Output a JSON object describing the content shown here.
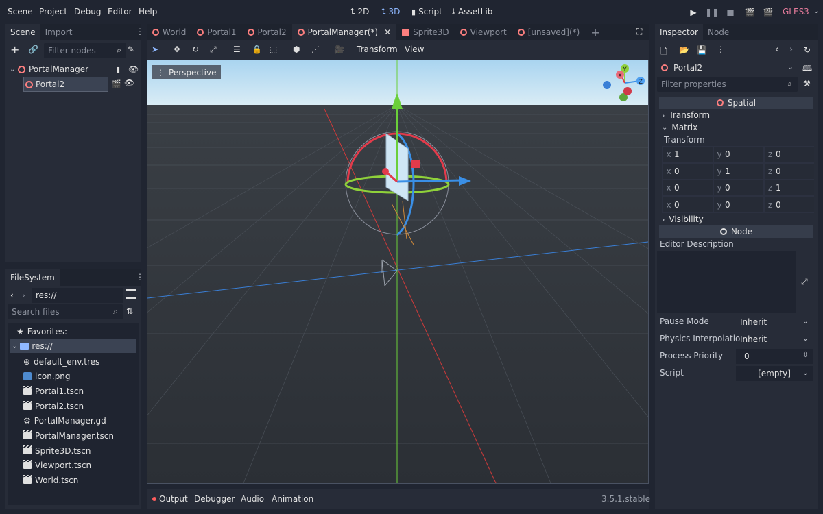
{
  "menu": [
    "Scene",
    "Project",
    "Debug",
    "Editor",
    "Help"
  ],
  "workspaces": [
    "2D",
    "3D",
    "Script",
    "AssetLib"
  ],
  "renderer": "GLES3",
  "scene_dock": {
    "tabs": [
      "Scene",
      "Import"
    ],
    "filter_placeholder": "Filter nodes",
    "nodes": [
      "PortalManager",
      "Portal2"
    ]
  },
  "filesystem": {
    "tab": "FileSystem",
    "path": "res://",
    "search_placeholder": "Search files",
    "favorites": "Favorites:",
    "root": "res://",
    "files": [
      "default_env.tres",
      "icon.png",
      "Portal1.tscn",
      "Portal2.tscn",
      "PortalManager.gd",
      "PortalManager.tscn",
      "Sprite3D.tscn",
      "Viewport.tscn",
      "World.tscn"
    ]
  },
  "editor_tabs": [
    "World",
    "Portal1",
    "Portal2",
    "PortalManager(*)",
    "Sprite3D",
    "Viewport",
    "[unsaved](*)"
  ],
  "toolbar": {
    "transform": "Transform",
    "view": "View"
  },
  "viewport": {
    "mode": "Perspective"
  },
  "gizmo_labels": {
    "y": "Y",
    "x": "X",
    "z": "Z"
  },
  "bottom": {
    "tabs": [
      "Output",
      "Debugger",
      "Audio",
      "Animation"
    ],
    "version": "3.5.1.stable"
  },
  "inspector": {
    "tabs": [
      "Inspector",
      "Node"
    ],
    "object": "Portal2",
    "filter_placeholder": "Filter properties",
    "spatial": "Spatial",
    "transform": "Transform",
    "matrix": "Matrix",
    "transform_label": "Transform",
    "matrix_rows": [
      [
        {
          "a": "x",
          "v": "1"
        },
        {
          "a": "y",
          "v": "0"
        },
        {
          "a": "z",
          "v": "0"
        }
      ],
      [
        {
          "a": "x",
          "v": "0"
        },
        {
          "a": "y",
          "v": "1"
        },
        {
          "a": "z",
          "v": "0"
        }
      ],
      [
        {
          "a": "x",
          "v": "0"
        },
        {
          "a": "y",
          "v": "0"
        },
        {
          "a": "z",
          "v": "1"
        }
      ],
      [
        {
          "a": "x",
          "v": "0"
        },
        {
          "a": "y",
          "v": "0"
        },
        {
          "a": "z",
          "v": "0"
        }
      ]
    ],
    "visibility": "Visibility",
    "node": "Node",
    "editor_description": "Editor Description",
    "props": [
      {
        "label": "Pause Mode",
        "value": "Inherit"
      },
      {
        "label": "Physics Interpolatio",
        "value": "Inherit"
      },
      {
        "label": "Process Priority",
        "value": "0"
      },
      {
        "label": "Script",
        "value": "[empty]"
      }
    ]
  },
  "colors": {
    "accent": "#8fb8ff",
    "node_icon": "#fc7f7f",
    "renderer": "#e37a9a"
  }
}
